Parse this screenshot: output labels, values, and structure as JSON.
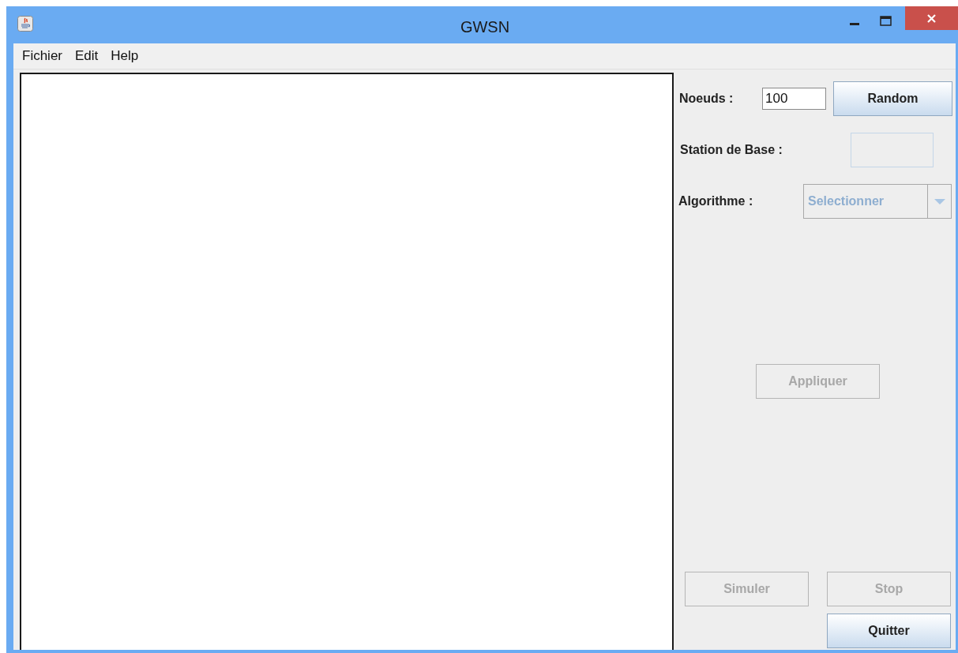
{
  "window": {
    "title": "GWSN"
  },
  "menu": [
    "Fichier",
    "Edit",
    "Help"
  ],
  "nodes": {
    "label": "Noeuds :",
    "value": "100"
  },
  "random_button": {
    "label": "Random",
    "disabled": false
  },
  "base_station": {
    "label": "Station de Base :",
    "disabled": true
  },
  "algorithm": {
    "label": "Algorithme :",
    "placeholder": "Selectionner",
    "disabled": true
  },
  "apply_button": {
    "label": "Appliquer",
    "disabled": true
  },
  "simulate_button": {
    "label": "Simuler",
    "disabled": true
  },
  "stop_button": {
    "label": "Stop",
    "disabled": true
  },
  "quit_button": {
    "label": "Quitter",
    "disabled": false
  }
}
